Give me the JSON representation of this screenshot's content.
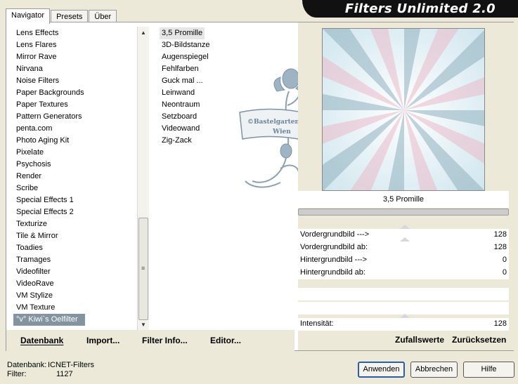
{
  "app_title": "Filters Unlimited 2.0",
  "tabs": [
    "Navigator",
    "Presets",
    "Über"
  ],
  "categories": [
    "Lens Effects",
    "Lens Flares",
    "Mirror Rave",
    "Nirvana",
    "Noise Filters",
    "Paper Backgrounds",
    "Paper Textures",
    "Pattern Generators",
    "penta.com",
    "Photo Aging Kit",
    "Pixelate",
    "Psychosis",
    "Render",
    "Scribe",
    "Special Effects 1",
    "Special Effects 2",
    "Texturize",
    "Tile & Mirror",
    "Toadies",
    "Tramages",
    "Videofilter",
    "VideoRave",
    "VM Stylize",
    "VM Texture",
    "°v° Kiwi`s Oelfilter"
  ],
  "selected_category": "°v° Kiwi`s Oelfilter",
  "filters": [
    "3,5 Promille",
    "3D-Bildstanze",
    "Augenspiegel",
    "Fehlfarben",
    "Guck mal ...",
    "Leinwand",
    "Neontraum",
    "Setzboard",
    "Videowand",
    "Zig-Zack"
  ],
  "selected_filter": "3,5 Promille",
  "watermark": {
    "line1": "©Bastelgarten",
    "line2": "Wien"
  },
  "bottom_links": {
    "datenbank": "Datenbank",
    "import": "Import...",
    "filter_info": "Filter Info...",
    "editor": "Editor..."
  },
  "preview_name": "3,5 Promille",
  "params": [
    {
      "label": "Vordergrundbild --->",
      "value": "128"
    },
    {
      "label": "Vordergrundbild ab:",
      "value": "128"
    },
    {
      "label": "Hintergrundbild --->",
      "value": "0"
    },
    {
      "label": "Hintergrundbild ab:",
      "value": "0"
    }
  ],
  "intensity": {
    "label": "Intensität:",
    "value": "128"
  },
  "random_buttons": {
    "random": "Zufallswerte",
    "reset": "Zurücksetzen"
  },
  "status": {
    "db_label": "Datenbank:",
    "db_value": "ICNET-Filters",
    "filter_label": "Filter:",
    "filter_value": "1127"
  },
  "buttons": {
    "apply": "Anwenden",
    "cancel": "Abbrechen",
    "help": "Hilfe"
  },
  "colors": {
    "selection": "#8394a0",
    "banner": "#111111",
    "panel_bg": "#ece9d8"
  }
}
